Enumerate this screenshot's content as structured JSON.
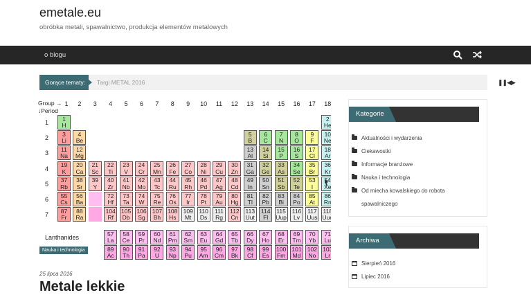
{
  "site": {
    "title": "emetale.eu",
    "description": "obróbka metali, spawalnictwo, produkcja elementów metalowych"
  },
  "nav": {
    "item": "o blogu",
    "search_icon": "search-icon",
    "shuffle_icon": "shuffle-icon"
  },
  "ticker": {
    "label": "Gorące tematy:",
    "text": "Targi METAL 2016",
    "controls": "❚❚◀▶"
  },
  "ptable": {
    "group_header": "Group →",
    "period_header": "↓Period",
    "groups": [
      "1",
      "2",
      "3",
      "4",
      "5",
      "6",
      "7",
      "8",
      "9",
      "10",
      "11",
      "12",
      "13",
      "14",
      "15",
      "16",
      "17",
      "18"
    ],
    "periods": [
      "1",
      "2",
      "3",
      "4",
      "5",
      "6",
      "7"
    ],
    "lanthanides_label": "Lanthanides",
    "colors": {
      "nonmetal": "#a6e89b",
      "noble": "#c5f1f1",
      "alkali": "#ff9c9c",
      "alkaline": "#ffd8a8",
      "transition": "#ffc7c7",
      "post": "#cfcfcf",
      "metalloid": "#d0d09a",
      "halogen": "#fbfb98",
      "lanthanide": "#ffbdf0",
      "actinide": "#ffa8e3",
      "unknown": "#eeeeee"
    },
    "elements": [
      {
        "n": "1",
        "s": "H",
        "g": 1,
        "p": 1,
        "c": "nonmetal"
      },
      {
        "n": "2",
        "s": "He",
        "g": 18,
        "p": 1,
        "c": "noble"
      },
      {
        "n": "3",
        "s": "Li",
        "g": 1,
        "p": 2,
        "c": "alkali"
      },
      {
        "n": "4",
        "s": "Be",
        "g": 2,
        "p": 2,
        "c": "alkaline"
      },
      {
        "n": "5",
        "s": "B",
        "g": 13,
        "p": 2,
        "c": "metalloid"
      },
      {
        "n": "6",
        "s": "C",
        "g": 14,
        "p": 2,
        "c": "nonmetal"
      },
      {
        "n": "7",
        "s": "N",
        "g": 15,
        "p": 2,
        "c": "nonmetal"
      },
      {
        "n": "8",
        "s": "O",
        "g": 16,
        "p": 2,
        "c": "nonmetal"
      },
      {
        "n": "9",
        "s": "F",
        "g": 17,
        "p": 2,
        "c": "halogen"
      },
      {
        "n": "10",
        "s": "Ne",
        "g": 18,
        "p": 2,
        "c": "noble"
      },
      {
        "n": "11",
        "s": "Na",
        "g": 1,
        "p": 3,
        "c": "alkali"
      },
      {
        "n": "12",
        "s": "Mg",
        "g": 2,
        "p": 3,
        "c": "alkaline"
      },
      {
        "n": "13",
        "s": "Al",
        "g": 13,
        "p": 3,
        "c": "post"
      },
      {
        "n": "14",
        "s": "Si",
        "g": 14,
        "p": 3,
        "c": "metalloid"
      },
      {
        "n": "15",
        "s": "P",
        "g": 15,
        "p": 3,
        "c": "nonmetal"
      },
      {
        "n": "16",
        "s": "S",
        "g": 16,
        "p": 3,
        "c": "nonmetal"
      },
      {
        "n": "17",
        "s": "Cl",
        "g": 17,
        "p": 3,
        "c": "halogen"
      },
      {
        "n": "18",
        "s": "Ar",
        "g": 18,
        "p": 3,
        "c": "noble"
      },
      {
        "n": "19",
        "s": "K",
        "g": 1,
        "p": 4,
        "c": "alkali"
      },
      {
        "n": "20",
        "s": "Ca",
        "g": 2,
        "p": 4,
        "c": "alkaline"
      },
      {
        "n": "21",
        "s": "Sc",
        "g": 3,
        "p": 4,
        "c": "transition"
      },
      {
        "n": "22",
        "s": "Ti",
        "g": 4,
        "p": 4,
        "c": "transition"
      },
      {
        "n": "23",
        "s": "V",
        "g": 5,
        "p": 4,
        "c": "transition"
      },
      {
        "n": "24",
        "s": "Cr",
        "g": 6,
        "p": 4,
        "c": "transition"
      },
      {
        "n": "25",
        "s": "Mn",
        "g": 7,
        "p": 4,
        "c": "transition"
      },
      {
        "n": "26",
        "s": "Fe",
        "g": 8,
        "p": 4,
        "c": "transition"
      },
      {
        "n": "27",
        "s": "Co",
        "g": 9,
        "p": 4,
        "c": "transition"
      },
      {
        "n": "28",
        "s": "Ni",
        "g": 10,
        "p": 4,
        "c": "transition"
      },
      {
        "n": "29",
        "s": "Cu",
        "g": 11,
        "p": 4,
        "c": "transition"
      },
      {
        "n": "30",
        "s": "Zn",
        "g": 12,
        "p": 4,
        "c": "transition"
      },
      {
        "n": "31",
        "s": "Ga",
        "g": 13,
        "p": 4,
        "c": "post"
      },
      {
        "n": "32",
        "s": "Ge",
        "g": 14,
        "p": 4,
        "c": "metalloid"
      },
      {
        "n": "33",
        "s": "As",
        "g": 15,
        "p": 4,
        "c": "metalloid"
      },
      {
        "n": "34",
        "s": "Se",
        "g": 16,
        "p": 4,
        "c": "nonmetal"
      },
      {
        "n": "35",
        "s": "Br",
        "g": 17,
        "p": 4,
        "c": "halogen"
      },
      {
        "n": "36",
        "s": "Kr",
        "g": 18,
        "p": 4,
        "c": "noble"
      },
      {
        "n": "37",
        "s": "Rb",
        "g": 1,
        "p": 5,
        "c": "alkali"
      },
      {
        "n": "38",
        "s": "Sr",
        "g": 2,
        "p": 5,
        "c": "alkaline"
      },
      {
        "n": "39",
        "s": "Y",
        "g": 3,
        "p": 5,
        "c": "transition"
      },
      {
        "n": "40",
        "s": "Zr",
        "g": 4,
        "p": 5,
        "c": "transition"
      },
      {
        "n": "41",
        "s": "Nb",
        "g": 5,
        "p": 5,
        "c": "transition"
      },
      {
        "n": "42",
        "s": "Mo",
        "g": 6,
        "p": 5,
        "c": "transition"
      },
      {
        "n": "43",
        "s": "Tc",
        "g": 7,
        "p": 5,
        "c": "transition"
      },
      {
        "n": "44",
        "s": "Ru",
        "g": 8,
        "p": 5,
        "c": "transition"
      },
      {
        "n": "45",
        "s": "Rh",
        "g": 9,
        "p": 5,
        "c": "transition"
      },
      {
        "n": "46",
        "s": "Pd",
        "g": 10,
        "p": 5,
        "c": "transition"
      },
      {
        "n": "47",
        "s": "Ag",
        "g": 11,
        "p": 5,
        "c": "transition"
      },
      {
        "n": "48",
        "s": "Cd",
        "g": 12,
        "p": 5,
        "c": "transition"
      },
      {
        "n": "49",
        "s": "In",
        "g": 13,
        "p": 5,
        "c": "post"
      },
      {
        "n": "50",
        "s": "Sn",
        "g": 14,
        "p": 5,
        "c": "post"
      },
      {
        "n": "51",
        "s": "Sb",
        "g": 15,
        "p": 5,
        "c": "metalloid"
      },
      {
        "n": "52",
        "s": "Te",
        "g": 16,
        "p": 5,
        "c": "metalloid"
      },
      {
        "n": "53",
        "s": "I",
        "g": 17,
        "p": 5,
        "c": "halogen"
      },
      {
        "n": "54",
        "s": "Xe",
        "g": 18,
        "p": 5,
        "c": "noble"
      },
      {
        "n": "55",
        "s": "Cs",
        "g": 1,
        "p": 6,
        "c": "alkali"
      },
      {
        "n": "56",
        "s": "Ba",
        "g": 2,
        "p": 6,
        "c": "alkaline"
      },
      {
        "n": "",
        "s": "",
        "g": 3,
        "p": 6,
        "c": "lanthanide"
      },
      {
        "n": "72",
        "s": "Hf",
        "g": 4,
        "p": 6,
        "c": "transition"
      },
      {
        "n": "73",
        "s": "Ta",
        "g": 5,
        "p": 6,
        "c": "transition"
      },
      {
        "n": "74",
        "s": "W",
        "g": 6,
        "p": 6,
        "c": "transition"
      },
      {
        "n": "75",
        "s": "Re",
        "g": 7,
        "p": 6,
        "c": "transition"
      },
      {
        "n": "76",
        "s": "Os",
        "g": 8,
        "p": 6,
        "c": "transition"
      },
      {
        "n": "77",
        "s": "Ir",
        "g": 9,
        "p": 6,
        "c": "transition"
      },
      {
        "n": "78",
        "s": "Pt",
        "g": 10,
        "p": 6,
        "c": "transition"
      },
      {
        "n": "79",
        "s": "Au",
        "g": 11,
        "p": 6,
        "c": "transition"
      },
      {
        "n": "80",
        "s": "Hg",
        "g": 12,
        "p": 6,
        "c": "transition"
      },
      {
        "n": "81",
        "s": "Tl",
        "g": 13,
        "p": 6,
        "c": "post"
      },
      {
        "n": "82",
        "s": "Pb",
        "g": 14,
        "p": 6,
        "c": "post"
      },
      {
        "n": "83",
        "s": "Bi",
        "g": 15,
        "p": 6,
        "c": "post"
      },
      {
        "n": "84",
        "s": "Po",
        "g": 16,
        "p": 6,
        "c": "post"
      },
      {
        "n": "85",
        "s": "At",
        "g": 17,
        "p": 6,
        "c": "halogen"
      },
      {
        "n": "86",
        "s": "Rn",
        "g": 18,
        "p": 6,
        "c": "noble"
      },
      {
        "n": "87",
        "s": "Fr",
        "g": 1,
        "p": 7,
        "c": "alkali"
      },
      {
        "n": "88",
        "s": "Ra",
        "g": 2,
        "p": 7,
        "c": "alkaline"
      },
      {
        "n": "",
        "s": "",
        "g": 3,
        "p": 7,
        "c": "actinide"
      },
      {
        "n": "104",
        "s": "Rf",
        "g": 4,
        "p": 7,
        "c": "transition"
      },
      {
        "n": "105",
        "s": "Db",
        "g": 5,
        "p": 7,
        "c": "transition"
      },
      {
        "n": "106",
        "s": "Sg",
        "g": 6,
        "p": 7,
        "c": "transition"
      },
      {
        "n": "107",
        "s": "Bh",
        "g": 7,
        "p": 7,
        "c": "transition"
      },
      {
        "n": "108",
        "s": "Hs",
        "g": 8,
        "p": 7,
        "c": "transition"
      },
      {
        "n": "109",
        "s": "Mt",
        "g": 9,
        "p": 7,
        "c": "unknown"
      },
      {
        "n": "110",
        "s": "Ds",
        "g": 10,
        "p": 7,
        "c": "unknown"
      },
      {
        "n": "111",
        "s": "Rg",
        "g": 11,
        "p": 7,
        "c": "unknown"
      },
      {
        "n": "112",
        "s": "Cn",
        "g": 12,
        "p": 7,
        "c": "transition"
      },
      {
        "n": "113",
        "s": "Uut",
        "g": 13,
        "p": 7,
        "c": "unknown"
      },
      {
        "n": "114",
        "s": "Fl",
        "g": 14,
        "p": 7,
        "c": "post"
      },
      {
        "n": "115",
        "s": "Uup",
        "g": 15,
        "p": 7,
        "c": "unknown"
      },
      {
        "n": "116",
        "s": "Lv",
        "g": 16,
        "p": 7,
        "c": "unknown"
      },
      {
        "n": "117",
        "s": "Uus",
        "g": 17,
        "p": 7,
        "c": "unknown"
      },
      {
        "n": "118",
        "s": "Uuo",
        "g": 18,
        "p": 7,
        "c": "unknown"
      }
    ],
    "lanthanides": [
      {
        "n": "57",
        "s": "La"
      },
      {
        "n": "58",
        "s": "Ce"
      },
      {
        "n": "59",
        "s": "Pr"
      },
      {
        "n": "60",
        "s": "Nd"
      },
      {
        "n": "61",
        "s": "Pm"
      },
      {
        "n": "62",
        "s": "Sm"
      },
      {
        "n": "63",
        "s": "Eu"
      },
      {
        "n": "64",
        "s": "Gd"
      },
      {
        "n": "65",
        "s": "Tb"
      },
      {
        "n": "66",
        "s": "Dy"
      },
      {
        "n": "67",
        "s": "Ho"
      },
      {
        "n": "68",
        "s": "Er"
      },
      {
        "n": "69",
        "s": "Tm"
      },
      {
        "n": "70",
        "s": "Yb"
      },
      {
        "n": "71",
        "s": "Lu"
      }
    ],
    "actinides": [
      {
        "n": "89",
        "s": "Ac"
      },
      {
        "n": "90",
        "s": "Th"
      },
      {
        "n": "91",
        "s": "Pa"
      },
      {
        "n": "92",
        "s": "U"
      },
      {
        "n": "93",
        "s": "Np"
      },
      {
        "n": "94",
        "s": "Pu"
      },
      {
        "n": "95",
        "s": "Am"
      },
      {
        "n": "96",
        "s": "Cm"
      },
      {
        "n": "97",
        "s": "Bk"
      },
      {
        "n": "98",
        "s": "Cf"
      },
      {
        "n": "99",
        "s": "Es"
      },
      {
        "n": "100",
        "s": "Fm"
      },
      {
        "n": "101",
        "s": "Md"
      },
      {
        "n": "102",
        "s": "No"
      },
      {
        "n": "103",
        "s": "Lr"
      }
    ]
  },
  "post": {
    "tag": "Nauka i technologia",
    "date": "25 lipca 2016",
    "title": "Metale lekkie"
  },
  "sidebar": {
    "categories": {
      "title": "Kategorie",
      "items": [
        "Aktualności i wydarzenia",
        "Ciekawostki",
        "Informacje branżowe",
        "Nauka i technologia",
        "Od miecha kowalskiego do robota spawalniczego"
      ]
    },
    "archive": {
      "title": "Archiwa",
      "items": [
        "Sierpień 2016",
        "Lipiec 2016"
      ]
    }
  }
}
